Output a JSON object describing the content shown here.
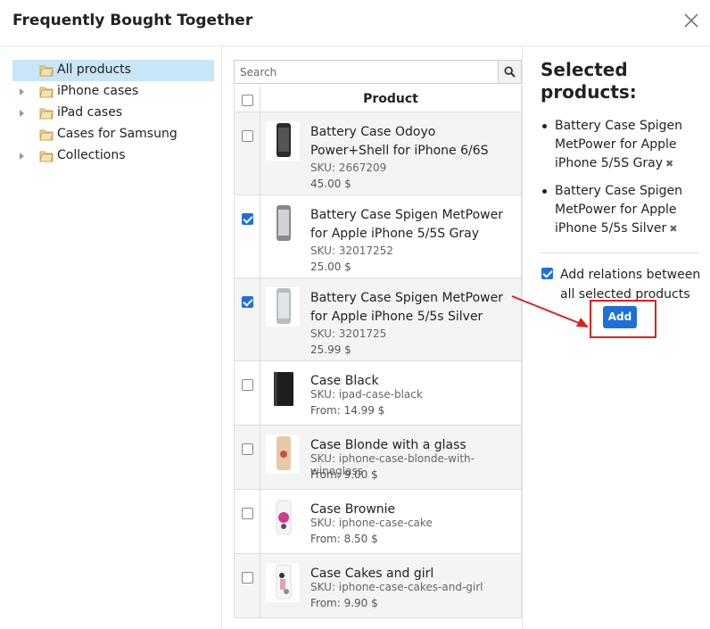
{
  "dialog": {
    "title": "Frequently Bought Together"
  },
  "tree": [
    {
      "label": "All products",
      "selected": true,
      "expandable": false
    },
    {
      "label": "iPhone cases",
      "selected": false,
      "expandable": true
    },
    {
      "label": "iPad cases",
      "selected": false,
      "expandable": true
    },
    {
      "label": "Cases for Samsung",
      "selected": false,
      "expandable": false
    },
    {
      "label": "Collections",
      "selected": false,
      "expandable": true
    }
  ],
  "search": {
    "placeholder": "Search",
    "value": ""
  },
  "table": {
    "header": "Product",
    "rows": [
      {
        "name": "Battery Case Odoyo Power+Shell for iPhone 6/6S",
        "sku": "SKU: 2667209",
        "price": "45.00 $",
        "checked": false,
        "thumb": "black-phone"
      },
      {
        "name": "Battery Case Spigen MetPower for Apple iPhone 5/5S Gray",
        "sku": "SKU: 32017252",
        "price": "25.00 $",
        "checked": true,
        "thumb": "gray-phone"
      },
      {
        "name": "Battery Case Spigen MetPower for Apple iPhone 5/5s Silver",
        "sku": "SKU: 3201725",
        "price": "25.99 $",
        "checked": true,
        "thumb": "silver-phone"
      },
      {
        "name": "Case Black",
        "sku": "SKU: ipad-case-black",
        "price": "From: 14.99 $",
        "checked": false,
        "thumb": "black-tablet"
      },
      {
        "name": "Case Blonde with a glass",
        "sku": "SKU: iphone-case-blonde-with-wineglass",
        "price": "From: 9.00 $",
        "checked": false,
        "thumb": "beige-case"
      },
      {
        "name": "Case Brownie",
        "sku": "SKU: iphone-case-cake",
        "price": "From: 8.50 $",
        "checked": false,
        "thumb": "pink-case"
      },
      {
        "name": "Case Cakes and girl",
        "sku": "SKU: iphone-case-cakes-and-girl",
        "price": "From: 9.90 $",
        "checked": false,
        "thumb": "girl-case"
      }
    ]
  },
  "selected": {
    "title": "Selected products:",
    "items": [
      "Battery Case Spigen MetPower for Apple iPhone 5/5S Gray",
      "Battery Case Spigen MetPower for Apple iPhone 5/5s Silver"
    ],
    "remove_glyph": "✖",
    "relations_label": "Add relations between all selected products",
    "relations_checked": true,
    "add_label": "Add"
  },
  "colors": {
    "accent": "#1f6fd9",
    "highlight": "#e02020",
    "tree_selected": "#c8e6f7"
  }
}
